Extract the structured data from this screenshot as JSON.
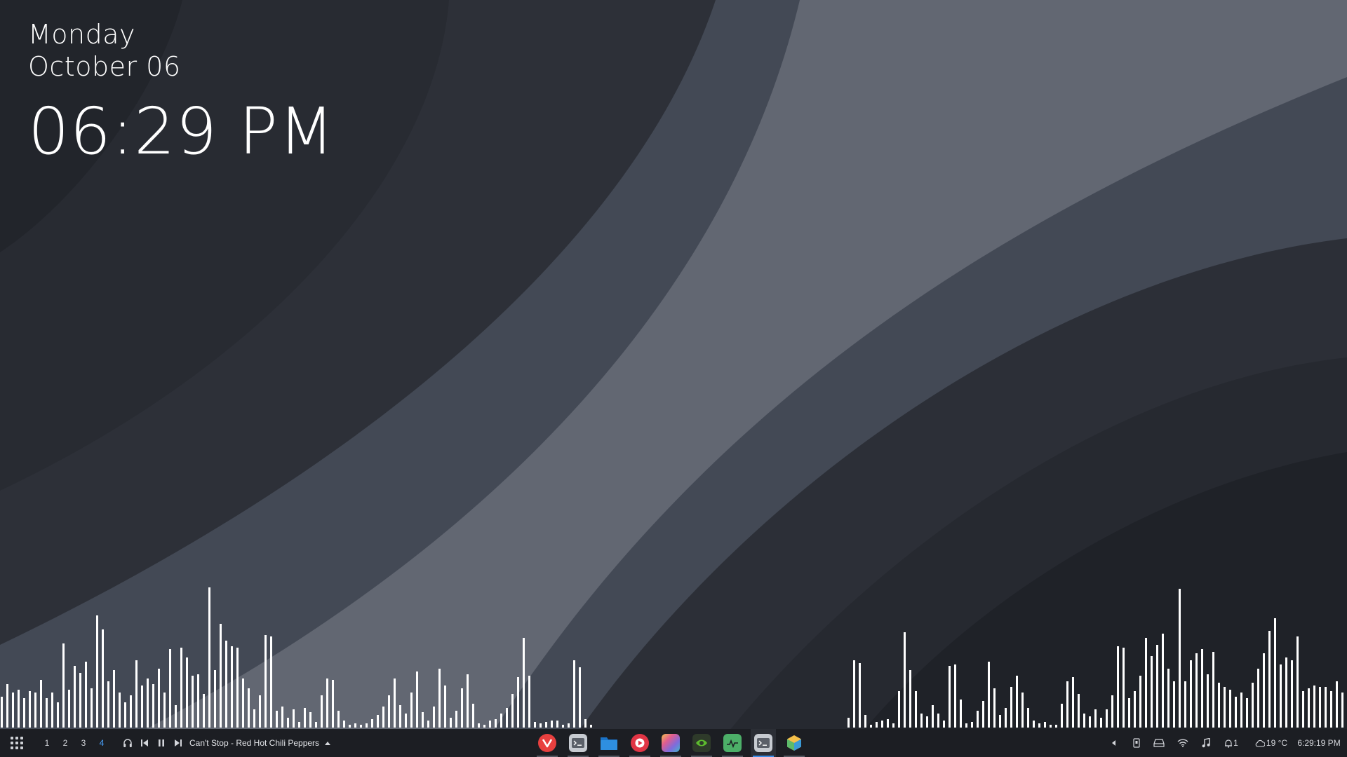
{
  "desktop": {
    "clock": {
      "day": "Monday",
      "date": "October 06",
      "time": "06:29 PM"
    },
    "visualizer_left": [
      0.22,
      0.31,
      0.25,
      0.27,
      0.21,
      0.26,
      0.25,
      0.34,
      0.21,
      0.25,
      0.18,
      0.6,
      0.27,
      0.44,
      0.39,
      0.47,
      0.28,
      0.8,
      0.7,
      0.33,
      0.41,
      0.25,
      0.18,
      0.23,
      0.48,
      0.3,
      0.35,
      0.31,
      0.42,
      0.25,
      0.56,
      0.16,
      0.57,
      0.5,
      0.37,
      0.38,
      0.24,
      1.0,
      0.41,
      0.74,
      0.62,
      0.58,
      0.57,
      0.35,
      0.28,
      0.13,
      0.23,
      0.66,
      0.65,
      0.12,
      0.15,
      0.07,
      0.13,
      0.04,
      0.14,
      0.11,
      0.04,
      0.23,
      0.35,
      0.34,
      0.12,
      0.05,
      0.02,
      0.03,
      0.02,
      0.03,
      0.06,
      0.09,
      0.15,
      0.23,
      0.35,
      0.16,
      0.1,
      0.25,
      0.4,
      0.11,
      0.05,
      0.15,
      0.42,
      0.3,
      0.07,
      0.12,
      0.28,
      0.38,
      0.17,
      0.03,
      0.02,
      0.05,
      0.06,
      0.1,
      0.14,
      0.24,
      0.36,
      0.64,
      0.37,
      0.04,
      0.03,
      0.04,
      0.05,
      0.05,
      0.02,
      0.03,
      0.48,
      0.43,
      0.06,
      0.02
    ],
    "visualizer_right": [
      0.07,
      0.48,
      0.46,
      0.09,
      0.02,
      0.04,
      0.05,
      0.06,
      0.03,
      0.26,
      0.68,
      0.41,
      0.26,
      0.1,
      0.08,
      0.16,
      0.1,
      0.05,
      0.44,
      0.45,
      0.2,
      0.03,
      0.04,
      0.12,
      0.19,
      0.47,
      0.28,
      0.09,
      0.14,
      0.29,
      0.37,
      0.25,
      0.14,
      0.05,
      0.03,
      0.04,
      0.02,
      0.02,
      0.17,
      0.33,
      0.36,
      0.24,
      0.1,
      0.08,
      0.13,
      0.07,
      0.13,
      0.23,
      0.58,
      0.57,
      0.21,
      0.26,
      0.37,
      0.64,
      0.51,
      0.59,
      0.67,
      0.42,
      0.33,
      0.99,
      0.33,
      0.48,
      0.53,
      0.56,
      0.38,
      0.54,
      0.32,
      0.29,
      0.27,
      0.22,
      0.25,
      0.21,
      0.32,
      0.42,
      0.53,
      0.69,
      0.78,
      0.45,
      0.5,
      0.48,
      0.65,
      0.26,
      0.28,
      0.3,
      0.29,
      0.29,
      0.26,
      0.33,
      0.25,
      0.3
    ]
  },
  "taskbar": {
    "workspaces": [
      "1",
      "2",
      "3",
      "4"
    ],
    "media": {
      "title": "Can't Stop - Red Hot Chili Peppers"
    },
    "apps": [
      {
        "name": "vivaldi-icon",
        "color": "#e8403f"
      },
      {
        "name": "terminal-icon",
        "color": "#9aa0a8"
      },
      {
        "name": "files-folder-icon",
        "color": "#2e8fe0"
      },
      {
        "name": "music-player-icon",
        "color": "#e13545"
      },
      {
        "name": "color-picker-icon",
        "color": "#c862d6"
      },
      {
        "name": "nvidia-settings-icon",
        "color": "#5dbb2f"
      },
      {
        "name": "system-monitor-icon",
        "color": "#4caf68"
      },
      {
        "name": "terminal-icon",
        "color": "#9aa0a8"
      },
      {
        "name": "package-manager-icon",
        "color": "#e07a3a"
      }
    ],
    "tray": {
      "notifications_count": "1",
      "weather": "19 °C",
      "clock": "6:29:19 PM"
    }
  }
}
